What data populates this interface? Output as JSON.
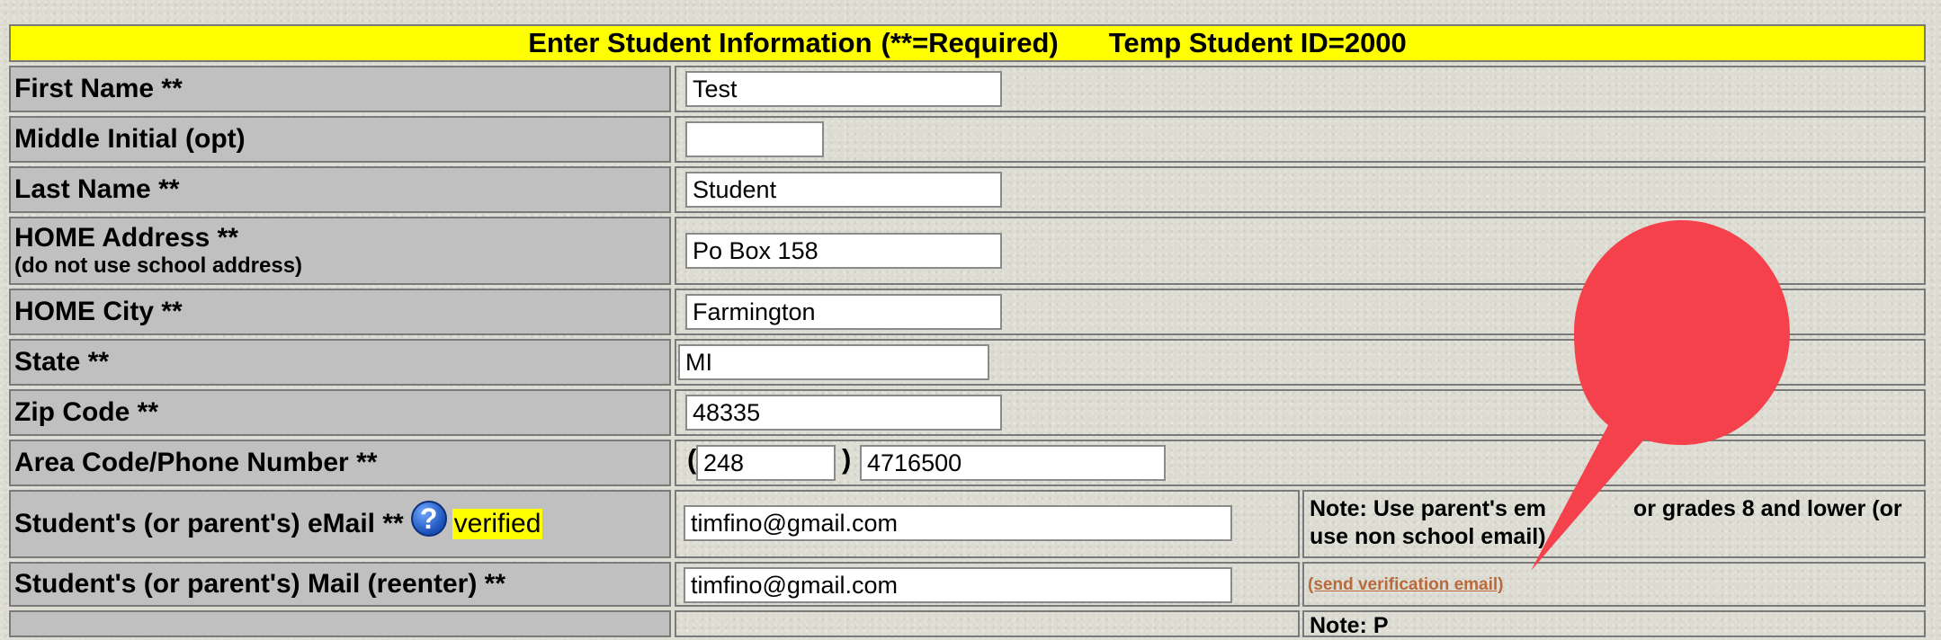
{
  "banner": {
    "title": "Enter Student Information",
    "required_note": "(**=Required)",
    "temp_id": "Temp Student ID=2000"
  },
  "fields": {
    "first_name": {
      "label": "First Name **",
      "value": "Test"
    },
    "middle_initial": {
      "label": "Middle Initial (opt)",
      "value": ""
    },
    "last_name": {
      "label": "Last Name **",
      "value": "Student"
    },
    "home_address": {
      "label": "HOME Address **",
      "sublabel": "(do not use school address)",
      "value": "Po Box 158"
    },
    "home_city": {
      "label": "HOME City **",
      "value": "Farmington"
    },
    "state": {
      "label": "State **",
      "value": "MI"
    },
    "zip": {
      "label": "Zip Code **",
      "value": "48335"
    },
    "phone": {
      "label": "Area Code/Phone Number **",
      "open_paren": "(",
      "area_code": "248",
      "close_paren": ")",
      "number": "4716500"
    },
    "email": {
      "label": "Student's (or parent's) eMail **",
      "help_icon": "question-icon",
      "verified": "verified",
      "value": "timfino@gmail.com"
    },
    "email_confirm": {
      "label": "Student's (or parent's) Mail (reenter) **",
      "value": "timfino@gmail.com"
    }
  },
  "notes": {
    "email_note_visible": "Note:  Use parent's em",
    "email_note_tail": "or grades 8 and lower (or",
    "email_note_line2": "use non school email)",
    "send_verification": "(send verification email)",
    "next_note_partial": "Note: P"
  },
  "annotation": {
    "balloon_color": "#f5414b"
  },
  "colors": {
    "banner": "#ffff00",
    "label_bg": "#c0c0c0",
    "link": "#b86a3c"
  }
}
